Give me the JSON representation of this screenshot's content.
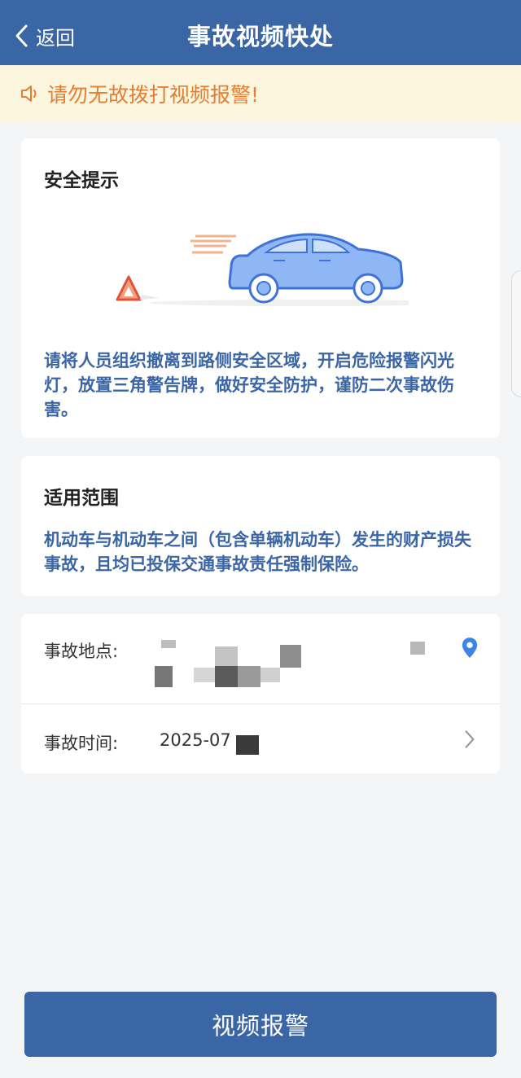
{
  "header": {
    "back_label": "返回",
    "title": "事故视频快处"
  },
  "notice": {
    "text": "请勿无故拨打视频报警!"
  },
  "safety_card": {
    "title": "安全提示",
    "text": "请将人员组织撤离到路侧安全区域，开启危险报警闪光灯，放置三角警告牌，做好安全防护，谨防二次事故伤害。"
  },
  "scope_card": {
    "title": "适用范围",
    "text": "机动车与机动车之间（包含单辆机动车）发生的财产损失事故，且均已投保交通事故责任强制保险。"
  },
  "form": {
    "location_label": "事故地点:",
    "time_label": "事故时间:",
    "time_value": "2025-07"
  },
  "cta": {
    "label": "视频报警"
  },
  "colors": {
    "primary": "#3b66a6",
    "notice_bg": "#fdf6df",
    "notice_text": "#e57e32",
    "location_pin": "#3e86e6"
  },
  "icons": {
    "back": "chevron-left-icon",
    "notice": "speaker-icon",
    "location": "location-pin-icon",
    "time": "chevron-right-icon"
  }
}
